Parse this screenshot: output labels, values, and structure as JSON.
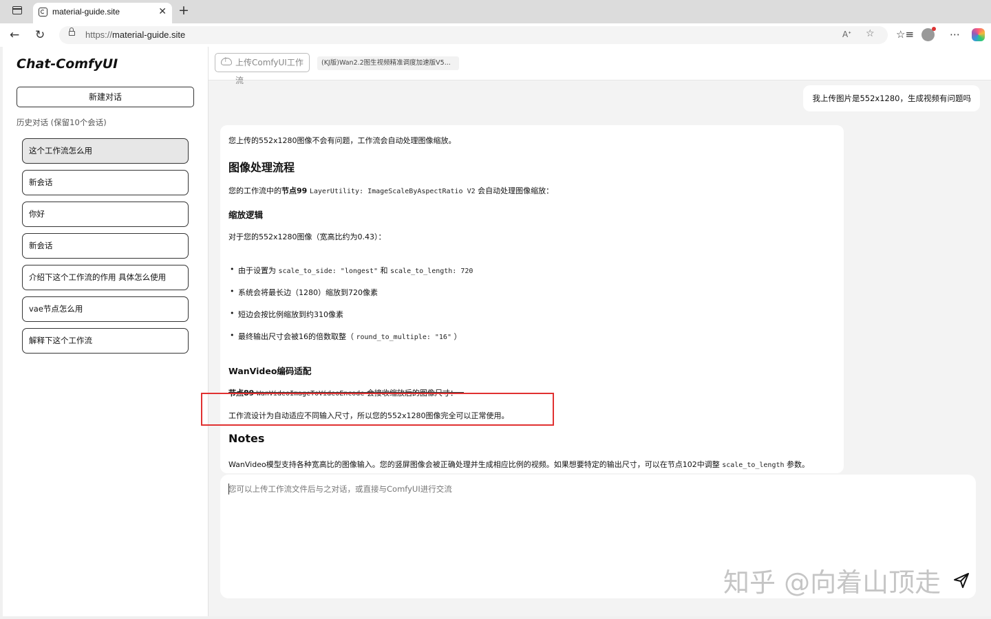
{
  "browser": {
    "tab_title": "material-guide.site",
    "url_prefix": "https://",
    "url_host": "material-guide.site"
  },
  "sidebar": {
    "brand": "Chat-ComfyUI",
    "new_chat_label": "新建对话",
    "history_label": "历史对话 (保留10个会话)",
    "items": [
      "这个工作流怎么用",
      "新会话",
      "你好",
      "新会话",
      "介绍下这个工作流的作用 具体怎么使用",
      "vae节点怎么用",
      "解释下这个工作流"
    ]
  },
  "topbar": {
    "upload_label": "上传ComfyUI工作流",
    "workflow_tag": "(KJ版)Wan2.2图生视频精准调度加速版V5..."
  },
  "conversation": {
    "user_message": "我上传图片是552x1280，生成视频有问题吗",
    "ai": {
      "intro": "您上传的552x1280图像不会有问题，工作流会自动处理图像缩放。",
      "h2_process": "图像处理流程",
      "p_node_pre": "您的工作流中的",
      "p_node_bold": "节点99",
      "p_node_code": "LayerUtility: ImageScaleByAspectRatio V2",
      "p_node_post": "会自动处理图像缩放：",
      "h3_logic": "缩放逻辑",
      "p_logic": "对于您的552x1280图像（宽高比约为0.43）：",
      "li1_pre": "由于设置为",
      "li1_code1": "scale_to_side: \"longest\"",
      "li1_mid": "和",
      "li1_code2": "scale_to_length: 720",
      "li2": "系统会将最长边（1280）缩放到720像素",
      "li3": "短边会按比例缩放到约310像素",
      "li4_pre": "最终输出尺寸会被16的倍数取整（",
      "li4_code": "round_to_multiple: \"16\"",
      "li4_post": "）",
      "h3_wan": "WanVideo编码适配",
      "p_wan_bold": "节点89",
      "p_wan_code": "WanVideoImageToVideoEncode",
      "p_wan_post": "会接收缩放后的图像尺寸：",
      "p_design": "工作流设计为自动适应不同输入尺寸，所以您的552x1280图像完全可以正常使用。",
      "h2_notes": "Notes",
      "p_notes_pre": "WanVideo模型支持各种宽高比的图像输入。您的竖屏图像会被正确处理并生成相应比例的视频。如果想要特定的输出尺寸，可以在节点102中调整",
      "p_notes_code": "scale_to_length",
      "p_notes_post": "参数。"
    }
  },
  "input": {
    "placeholder": "您可以上传工作流文件后与之对话，或直接与ComfyUI进行交流"
  },
  "watermark": "知乎 @向着山顶走",
  "icons": {
    "sidebar_toggle": "sidebar-toggle-icon",
    "back": "back-arrow-icon",
    "reload": "reload-icon",
    "send": "paper-plane-send-icon"
  },
  "colors": {
    "highlight_box": "#e03030",
    "active_history_item": "#e7e7e7"
  }
}
